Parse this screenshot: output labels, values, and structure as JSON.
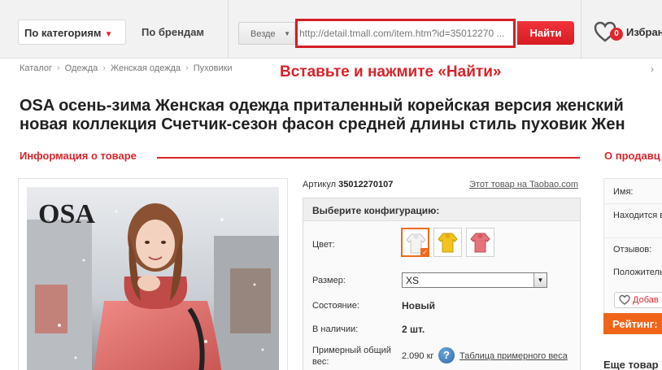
{
  "header": {
    "categories_label": "По категориям",
    "brands_label": "По брендам",
    "scope_label": "Везде",
    "url_value": "http://detail.tmall.com/item.htm?id=35012270 ...",
    "search_label": "Найти",
    "favorites_label": "Избран",
    "favorites_count": "0"
  },
  "breadcrumb": [
    "Каталог",
    "Одежда",
    "Женская одежда",
    "Пуховики"
  ],
  "hint": "Вставьте и нажмите «Найти»",
  "title_lines": [
    "OSA осень-зима Женская одежда приталенный корейская версия женский",
    "новая коллекция Счетчик-сезон фасон средней длины стиль пуховик Жен"
  ],
  "sections": {
    "product_info": "Информация о товаре",
    "seller": "О продавц"
  },
  "product": {
    "article_label": "Артикул",
    "article_value": "35012270107",
    "taobao_link": "Этот товар на Taobao.com",
    "brand_logo": "OSA"
  },
  "config": {
    "header": "Выберите конфигурацию:",
    "color_label": "Цвет:",
    "size_label": "Размер:",
    "size_value": "XS",
    "condition_label": "Состояние:",
    "condition_value": "Новый",
    "stock_label": "В наличии:",
    "stock_value": "2 шт.",
    "weight_label_1": "Примерный общий",
    "weight_label_2": "вес:",
    "weight_value": "2.090 кг",
    "weight_link": "Таблица примерного веса",
    "swatch_colors": [
      "#f3f3f0",
      "#f3c21c",
      "#e7737a"
    ],
    "selected_swatch": 0
  },
  "seller": {
    "name_label": "Имя:",
    "location_label": "Находится в",
    "reviews_label": "Отзывов:",
    "positive_label": "Положитель",
    "add_button": "Добав",
    "rating_label": "Рейтинг:",
    "more_label": "Еще товар"
  },
  "colors": {
    "accent": "#d8232a",
    "orange": "#f0641a"
  }
}
